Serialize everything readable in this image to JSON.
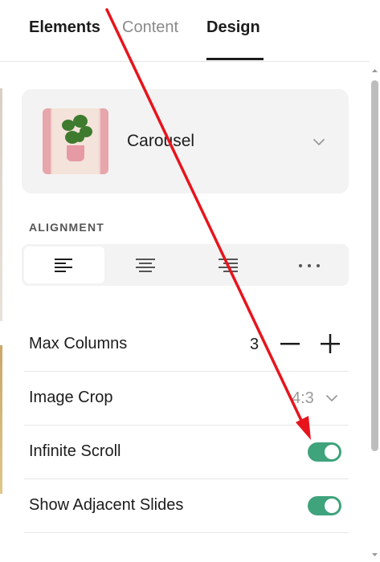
{
  "tabs": [
    {
      "label": "Elements",
      "active": false
    },
    {
      "label": "Content",
      "active": false
    },
    {
      "label": "Design",
      "active": true
    }
  ],
  "layout": {
    "name": "Carousel",
    "icon": "chevron-down-icon"
  },
  "alignment": {
    "label": "ALIGNMENT",
    "options": [
      "align-left",
      "align-center",
      "align-right",
      "more"
    ],
    "selected": "align-left"
  },
  "settings": {
    "max_columns": {
      "label": "Max Columns",
      "value": "3"
    },
    "image_crop": {
      "label": "Image Crop",
      "value": "4:3"
    },
    "infinite_scroll": {
      "label": "Infinite Scroll",
      "on": true
    },
    "show_adjacent_slides": {
      "label": "Show Adjacent Slides",
      "on": true
    }
  },
  "colors": {
    "toggle_on": "#3fa37c",
    "annotation_arrow": "#e8141c",
    "text": "#1c1c1c",
    "muted": "#9a9a9a"
  }
}
